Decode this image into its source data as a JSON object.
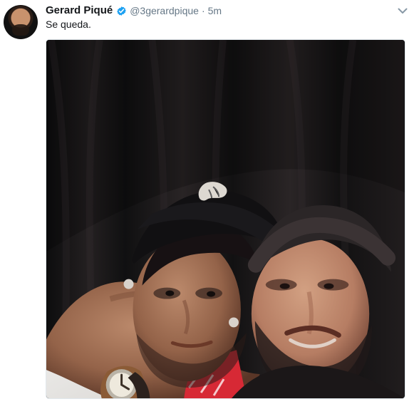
{
  "tweet": {
    "author_name": "Gerard Piqué",
    "handle": "@3gerardpique",
    "separator": "·",
    "timestamp": "5m",
    "text": "Se queda.",
    "verified_icon": "verified-badge-icon",
    "menu_icon": "chevron-down-icon",
    "accent_color": "#1da1f2",
    "secondary_text_color": "#657786"
  },
  "media": {
    "type": "photo",
    "description_icon": "selfie-photo"
  }
}
